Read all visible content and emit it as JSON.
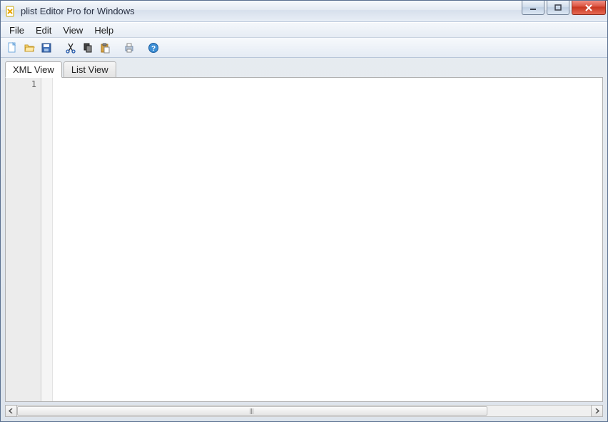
{
  "title": "plist Editor Pro for Windows",
  "menu": {
    "file": "File",
    "edit": "Edit",
    "view": "View",
    "help": "Help"
  },
  "toolbar": {
    "new": "new-file-icon",
    "open": "open-folder-icon",
    "save": "save-icon",
    "cut": "cut-icon",
    "copy": "copy-icon",
    "paste": "paste-icon",
    "print": "print-icon",
    "help": "help-icon"
  },
  "tabs": {
    "xml": "XML View",
    "list": "List View"
  },
  "editor": {
    "line_number": "1"
  }
}
